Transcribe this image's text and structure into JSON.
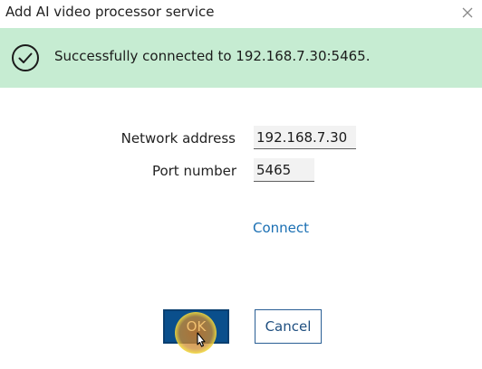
{
  "dialog": {
    "title": "Add AI video processor service",
    "close_icon": "close-icon"
  },
  "banner": {
    "icon": "check-circle-icon",
    "message": "Successfully connected to 192.168.7.30:5465.",
    "background_color": "#c6ecd2"
  },
  "form": {
    "address_label": "Network address",
    "address_value": "192.168.7.30",
    "port_label": "Port number",
    "port_value": "5465",
    "connect_label": "Connect"
  },
  "buttons": {
    "ok_label": "OK",
    "cancel_label": "Cancel"
  },
  "colors": {
    "accent": "#0a4f8c",
    "link": "#1a6fb3"
  }
}
